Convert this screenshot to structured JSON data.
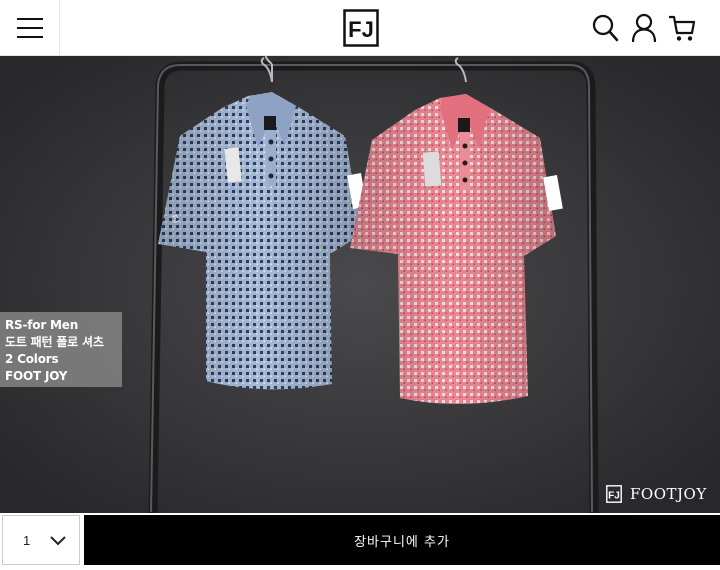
{
  "header": {
    "logo_text": "FJ",
    "icons": [
      "menu-icon",
      "search-icon",
      "user-icon",
      "cart-icon"
    ]
  },
  "hero": {
    "caption_lines": [
      "RS-for Men",
      "도트 패턴 폴로 셔츠",
      "2 Colors",
      "FOOT JOY"
    ],
    "brand_mark": "FJ",
    "brand_name": "FOOTJOY"
  },
  "purchase": {
    "quantity": "1",
    "add_to_cart_label": "장바구니에 추가"
  },
  "colors": {
    "blue_shirt": "#9fb3cf",
    "pink_shirt": "#e57f8a",
    "background": "#3a3a3c",
    "button": "#000000"
  }
}
